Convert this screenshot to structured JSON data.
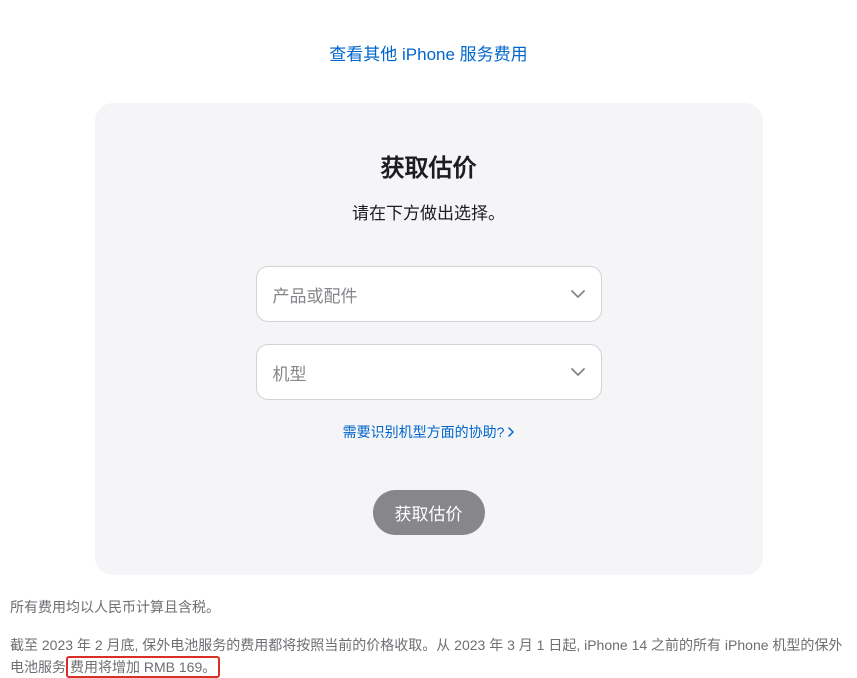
{
  "topLink": "查看其他 iPhone 服务费用",
  "card": {
    "title": "获取估价",
    "subtitle": "请在下方做出选择。",
    "select1Placeholder": "产品或配件",
    "select2Placeholder": "机型",
    "helpText": "需要识别机型方面的协助?",
    "buttonLabel": "获取估价"
  },
  "footer": {
    "line1": "所有费用均以人民币计算且含税。",
    "line2Part1": "截至 2023 年 2 月底, 保外电池服务的费用都将按照当前的价格收取。从 2023 年 3 月 1 日起, iPhone 14 之前的所有 iPhone 机型的保外电池服务",
    "line2Highlight": "费用将增加 RMB 169。"
  }
}
